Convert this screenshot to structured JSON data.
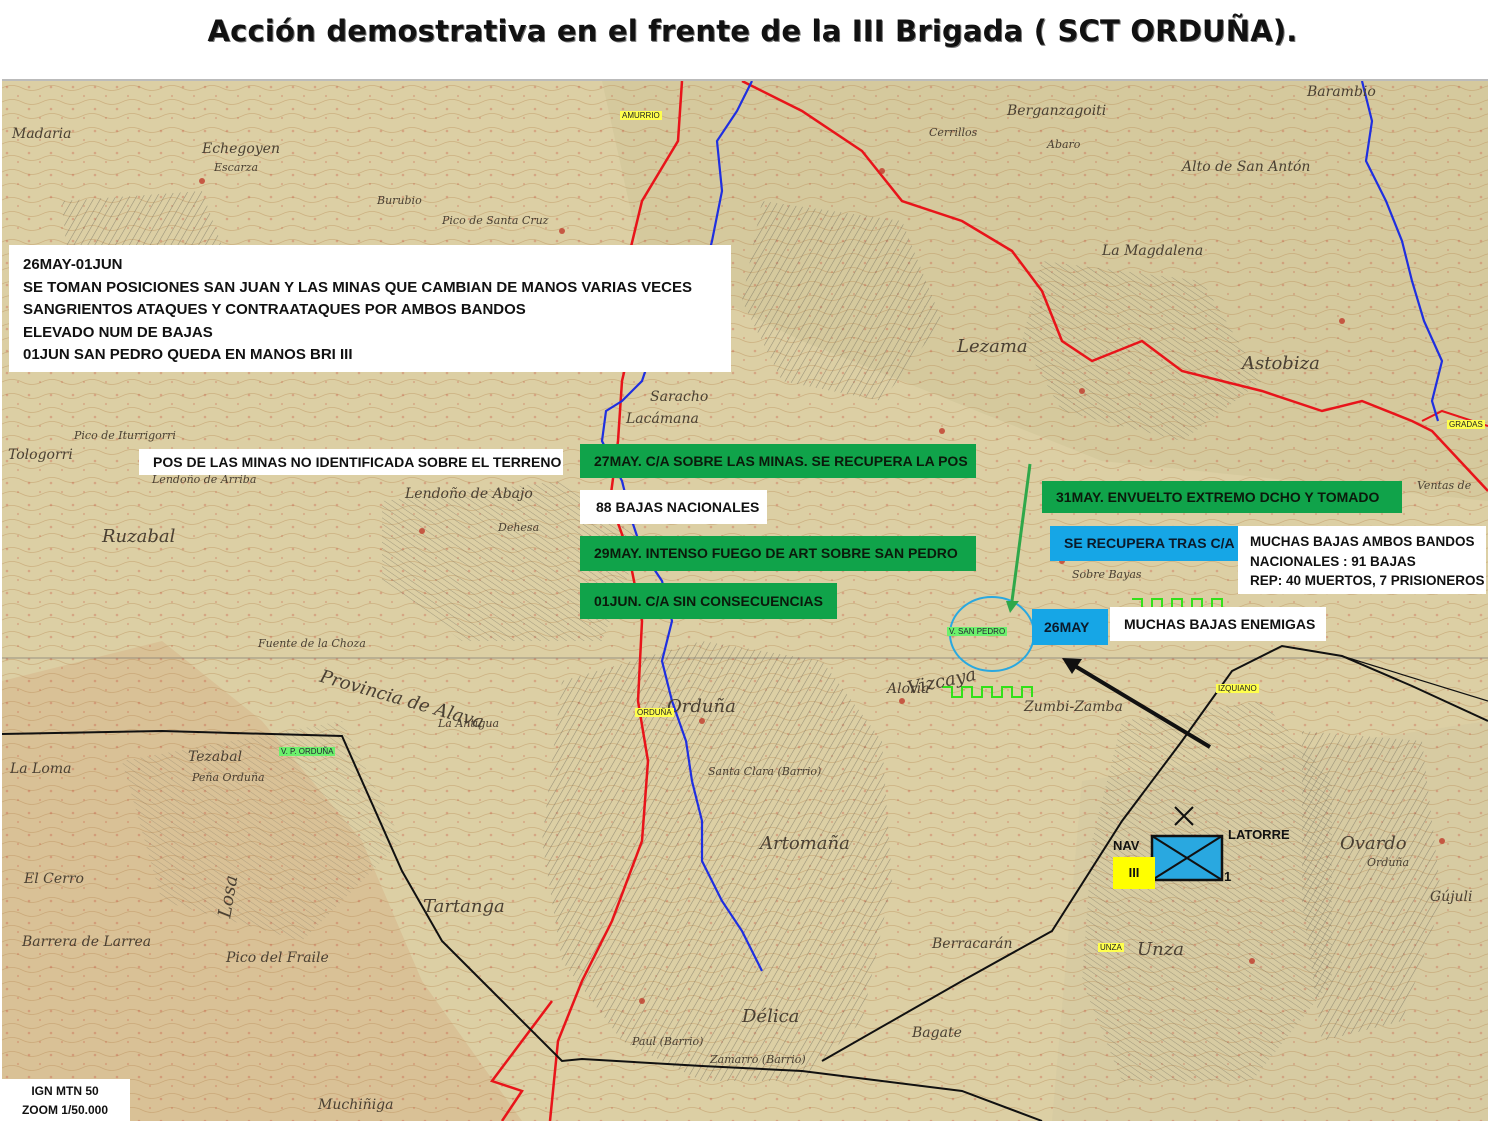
{
  "title": "Acción demostrativa en el frente de la III Brigada ( SCT ORDUÑA).",
  "summary": {
    "lines": [
      "26MAY-01JUN",
      "SE TOMAN POSICIONES SAN JUAN Y LAS MINAS QUE CAMBIAN DE MANOS VARIAS VECES",
      "SANGRIENTOS ATAQUES Y CONTRAATAQUES POR AMBOS BANDOS",
      "ELEVADO NUM DE BAJAS",
      "01JUN SAN PEDRO QUEDA EN MANOS BRI III"
    ]
  },
  "annotations": {
    "minas_not_identified": "POS DE LAS MINAS NO IDENTIFICADA SOBRE EL TERRENO",
    "may27": "27MAY. C/A SOBRE LAS MINAS. SE RECUPERA LA POS",
    "bajas88": "88 BAJAS NACIONALES",
    "may29": "29MAY. INTENSO FUEGO DE ART SOBRE SAN PEDRO",
    "jun01": "01JUN. C/A SIN CONSECUENCIAS",
    "may31": "31MAY. ENVUELTO EXTREMO DCHO Y TOMADO",
    "recupera": "SE RECUPERA TRAS C/A",
    "casualties": [
      "MUCHAS BAJAS AMBOS BANDOS",
      "NACIONALES : 91 BAJAS",
      "REP: 40 MUERTOS, 7 PRISIONEROS"
    ],
    "may26": "26MAY",
    "enemy": "MUCHAS BAJAS ENEMIGAS"
  },
  "unit_symbol": {
    "left_label": "NAV",
    "right_label": "LATORRE",
    "sub_label": "1",
    "echelon": "III",
    "fill_color": "#29a8e0",
    "echelon_color": "#ffff00"
  },
  "place_tags": {
    "amurrio": "AMURRIO",
    "san_pedro": "V. SAN PEDRO",
    "orduna": "ORDUÑA",
    "v_orduna": "V. P. ORDUÑA",
    "izquiano": "IZQUIANO",
    "unza": "UNZA",
    "gradas": "GRADAS"
  },
  "map_labels": [
    "Madaria",
    "Echegoyen",
    "Escarza",
    "Burubio",
    "Pico de Santa Cruz",
    "Cerrillos",
    "Berganzagoiti",
    "Abaro",
    "Barambio",
    "Alto de San Antón",
    "La Magdalena",
    "Lezama",
    "Astobiza",
    "Saracho",
    "Lacámana",
    "Pico de Iturrigorri",
    "Tologorri",
    "Lendoño de Arriba",
    "Lendoño de Abajo",
    "Ruzabal",
    "Dehesa",
    "Sobre Bayas",
    "Orduña",
    "Santa Clara (Barrio)",
    "Artomaña",
    "La Antigua",
    "Tezabal",
    "Peña Orduña",
    "La Loma",
    "El Cerro",
    "Tartanga",
    "Barrera de Larrea",
    "Pico del Fraile",
    "Délica",
    "Paul (Barrio)",
    "Zamarro (Barrio)",
    "Berracarán",
    "Bagate",
    "Unza",
    "Ovardo",
    "Orduña",
    "Gújuli",
    "Aloria",
    "Zumbi-Zamba",
    "Fuente de la Choza",
    "Muchiñiga",
    "Ventas de",
    "Vizcaya",
    "Provincia de Alava",
    "Losa"
  ],
  "source": [
    "IGN MTN 50",
    "ZOOM 1/50.000"
  ],
  "colors": {
    "road_red": "#e8141a",
    "river_blue": "#1f2fe0",
    "border_black": "#111111",
    "green_box": "#10a34a",
    "blue_box": "#16a6e6",
    "trench_green": "#33e01a"
  }
}
